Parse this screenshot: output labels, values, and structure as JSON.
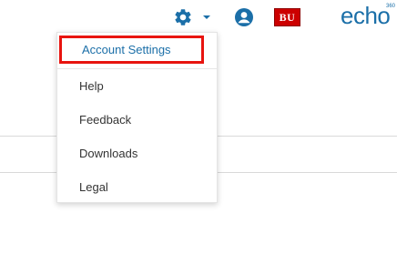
{
  "header": {
    "settings_icon": "gear-icon",
    "dropdown_icon": "caret-down-icon",
    "user_icon": "user-circle-icon",
    "institution_logo": "BU",
    "brand_logo": "echo",
    "brand_superscript": "360",
    "accent_color": "#1b6fa8",
    "institution_color": "#cc0000"
  },
  "menu": {
    "items": [
      {
        "label": "Account Settings",
        "highlighted": true
      },
      {
        "label": "Help"
      },
      {
        "label": "Feedback"
      },
      {
        "label": "Downloads"
      },
      {
        "label": "Legal"
      }
    ],
    "highlight_color": "#e8140f"
  }
}
